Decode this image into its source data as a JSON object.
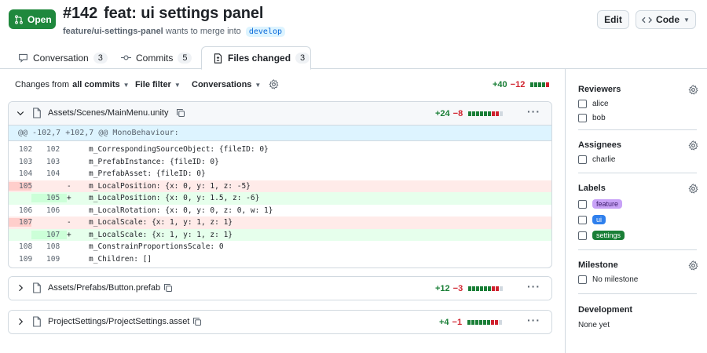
{
  "pr": {
    "status": "Open",
    "number": "#142",
    "title": "feat: ui settings panel",
    "source_branch": "feature/ui-settings-panel",
    "merge_text": "wants to merge into",
    "target_branch": "develop",
    "edit_label": "Edit",
    "code_label": "Code"
  },
  "tabs": [
    {
      "label": "Conversation",
      "count": "3"
    },
    {
      "label": "Commits",
      "count": "5"
    },
    {
      "label": "Files changed",
      "count": "3"
    }
  ],
  "toolbar": {
    "changes_prefix": "Changes from",
    "changes_value": "all commits",
    "file_filter": "File filter",
    "conversations": "Conversations",
    "additions": "+40",
    "deletions": "−12"
  },
  "files": [
    {
      "name": "Assets/Scenes/MainMenu.unity",
      "additions": "+24",
      "deletions": "−8",
      "expanded": true,
      "hunk": "@@ -102,7 +102,7 @@ MonoBehaviour:",
      "lines": [
        {
          "old": "102",
          "new": "102",
          "sign": "",
          "type": "ctx",
          "code": "m_CorrespondingSourceObject: {fileID: 0}"
        },
        {
          "old": "103",
          "new": "103",
          "sign": "",
          "type": "ctx",
          "code": "m_PrefabInstance: {fileID: 0}"
        },
        {
          "old": "104",
          "new": "104",
          "sign": "",
          "type": "ctx",
          "code": "m_PrefabAsset: {fileID: 0}"
        },
        {
          "old": "105",
          "new": "",
          "sign": "-",
          "type": "del",
          "code": "m_LocalPosition: {x: 0, y: 1, z: -5}"
        },
        {
          "old": "",
          "new": "105",
          "sign": "+",
          "type": "add",
          "code": "m_LocalPosition: {x: 0, y: 1.5, z: -6}"
        },
        {
          "old": "106",
          "new": "106",
          "sign": "",
          "type": "ctx",
          "code": "m_LocalRotation: {x: 0, y: 0, z: 0, w: 1}"
        },
        {
          "old": "107",
          "new": "",
          "sign": "-",
          "type": "del",
          "code": "m_LocalScale: {x: 1, y: 1, z: 1}"
        },
        {
          "old": "",
          "new": "107",
          "sign": "+",
          "type": "add",
          "code": "m_LocalScale: {x: 1, y: 1, z: 1}"
        },
        {
          "old": "108",
          "new": "108",
          "sign": "",
          "type": "ctx",
          "code": "m_ConstrainProportionsScale: 0"
        },
        {
          "old": "109",
          "new": "109",
          "sign": "",
          "type": "ctx",
          "code": "m_Children: []"
        }
      ]
    },
    {
      "name": "Assets/Prefabs/Button.prefab",
      "additions": "+12",
      "deletions": "−3",
      "expanded": false
    },
    {
      "name": "ProjectSettings/ProjectSettings.asset",
      "additions": "+4",
      "deletions": "−1",
      "expanded": false
    }
  ],
  "sidebar": {
    "reviewers_title": "Reviewers",
    "reviewers": [
      "alice",
      "bob"
    ],
    "assignees_title": "Assignees",
    "assignees": [
      "charlie"
    ],
    "labels_title": "Labels",
    "labels": [
      "feature",
      "ui",
      "settings"
    ],
    "milestone_title": "Milestone",
    "milestone_value": "No milestone",
    "development_title": "Development",
    "development_value": "None yet"
  },
  "colors": {
    "open": "#1f883d",
    "addition": "#1a7f37",
    "deletion": "#d1242f",
    "label_feature": "#c8a2f7",
    "label_ui": "#2f80ed",
    "label_settings": "#1a7f37"
  }
}
